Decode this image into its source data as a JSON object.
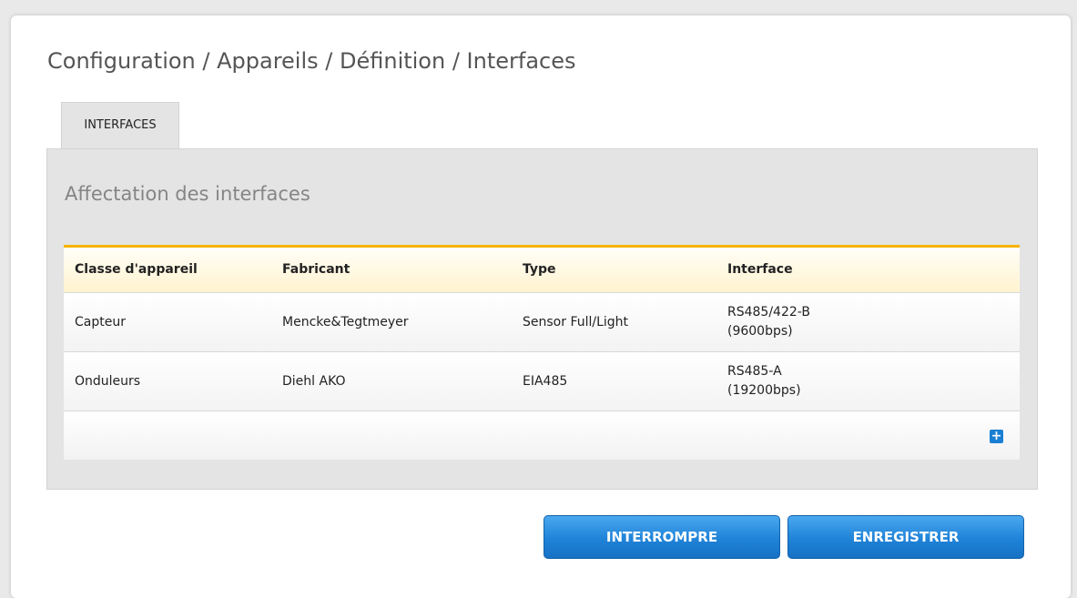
{
  "breadcrumb": "Configuration / Appareils / Définition / Interfaces",
  "tabs": [
    {
      "label": "INTERFACES"
    }
  ],
  "section_title": "Affectation des interfaces",
  "table": {
    "columns": [
      "Classe d'appareil",
      "Fabricant",
      "Type",
      "Interface"
    ],
    "rows": [
      {
        "device_class": "Capteur",
        "manufacturer": "Mencke&Tegtmeyer",
        "type": "Sensor Full/Light",
        "interface_line1": "RS485/422-B",
        "interface_line2": "(9600bps)"
      },
      {
        "device_class": "Onduleurs",
        "manufacturer": "Diehl AKO",
        "type": "EIA485",
        "interface_line1": "RS485-A",
        "interface_line2": "(19200bps)"
      }
    ],
    "add_icon": "+"
  },
  "buttons": {
    "cancel": "INTERROMPRE",
    "save": "ENREGISTRER"
  },
  "colors": {
    "accent_orange": "#f5b400",
    "button_blue": "#1f83d8",
    "add_icon_blue": "#1a7fd2"
  }
}
